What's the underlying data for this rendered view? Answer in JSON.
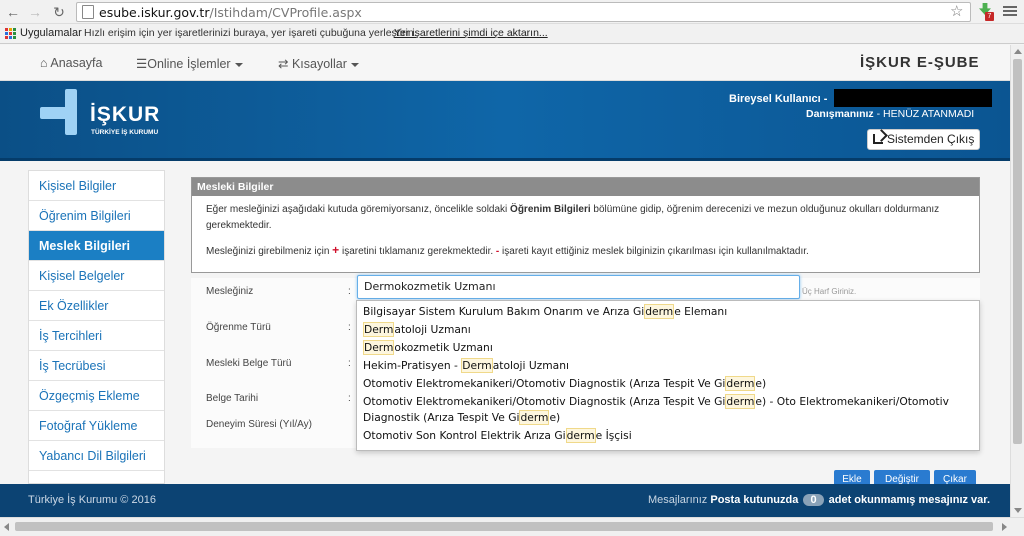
{
  "browser": {
    "url_host": "esube.iskur.gov.tr",
    "url_path": "/Istihdam/CVProfile.aspx",
    "bookmarks": {
      "apps_label": "Uygulamalar",
      "hint": "Hızlı erişim için yer işaretlerinizi buraya, yer işareti çubuğuna yerleştirin.",
      "import_link": "Yer işaretlerini şimdi içe aktarın..."
    },
    "extension_badge": "7"
  },
  "nav": {
    "home": "Anasayfa",
    "online": "Online İşlemler",
    "shortcuts": "Kısayollar",
    "brand": "İŞKUR E-ŞUBE"
  },
  "header": {
    "logo_name": "İŞKUR",
    "logo_sub": "TÜRKİYE İŞ KURUMU",
    "user_label": "Bireysel Kullanıcı -",
    "advisor_label": "Danışmanınız",
    "advisor_value": " - HENÜZ ATANMADI",
    "logout": "Sistemden Çıkış"
  },
  "sidebar": {
    "items": [
      {
        "label": "Kişisel Bilgiler"
      },
      {
        "label": "Öğrenim Bilgileri"
      },
      {
        "label": "Meslek Bilgileri",
        "active": true
      },
      {
        "label": "Kişisel Belgeler"
      },
      {
        "label": "Ek Özellikler"
      },
      {
        "label": "İş Tercihleri"
      },
      {
        "label": "İş Tecrübesi"
      },
      {
        "label": "Özgeçmiş Ekleme"
      },
      {
        "label": "Fotoğraf Yükleme"
      },
      {
        "label": "Yabancı Dil Bilgileri"
      }
    ]
  },
  "panel": {
    "title": "Mesleki Bilgiler",
    "info_1a": "Eğer mesleğinizi aşağıdaki kutuda göremiyorsanız, öncelikle soldaki ",
    "info_1b": "Öğrenim Bilgileri",
    "info_1c": " bölümüne gidip, öğrenim derecenizi ve mezun olduğunuz okulları doldurmanız gerekmektedir.",
    "info_2a": "Mesleğinizi girebilmeniz için ",
    "info_2plus": "+",
    "info_2b": " işaretini tıklamanız gerekmektedir. ",
    "info_2minus": "-",
    "info_2c": " işareti kayıt ettiğiniz meslek bilginizin çıkarılması için kullanılmaktadır."
  },
  "form": {
    "occupation_label": "Mesleğiniz",
    "occupation_value": "Dermokozmetik Uzmanı",
    "hint": "Üç Harf Giriniz.",
    "colon": ":",
    "learning_type_label": "Öğrenme Türü",
    "doc_type_label": "Mesleki Belge Türü",
    "doc_date_label": "Belge Tarihi",
    "experience_label": "Deneyim Süresi (Yıl/Ay)"
  },
  "autocomplete": [
    {
      "pre": "Bilgisayar Sistem Kurulum Bakım Onarım ve Arıza Gi",
      "hl": "derm",
      "post": "e Elemanı"
    },
    {
      "pre": "",
      "hl": "Derm",
      "post": "atoloji Uzmanı"
    },
    {
      "pre": "",
      "hl": "Derm",
      "post": "okozmetik Uzmanı"
    },
    {
      "pre": "Hekim-Pratisyen - ",
      "hl": "Derm",
      "post": "atoloji Uzmanı"
    },
    {
      "pre": "Otomotiv Elektromekanikeri/Otomotiv Diagnostik (Arıza Tespit Ve Gi",
      "hl": "derm",
      "post": "e)"
    },
    {
      "pre": "Otomotiv Elektromekanikeri/Otomotiv Diagnostik (Arıza Tespit Ve Gi",
      "hl": "derm",
      "mid": "e) - Oto Elektromekanikeri/Otomotiv Diagnostik (Arıza Tespit Ve Gi",
      "hl2": "derm",
      "post": "e)"
    },
    {
      "pre": "Otomotiv Son Kontrol Elektrik Arıza Gi",
      "hl": "derm",
      "post": "e İşçisi"
    }
  ],
  "buttons": {
    "add": "Ekle",
    "change": "Değiştir",
    "remove": "Çıkar"
  },
  "footer": {
    "copyright": "Türkiye İş Kurumu © 2016",
    "messages": "Mesajlarınız",
    "inbox": "Posta kutunuzda",
    "count": "0",
    "unread": "adet okunmamış mesajınız var."
  },
  "colors": {
    "brand_blue": "#0f66a8",
    "active_item": "#1b7fc4",
    "button_blue": "#2a7bd0",
    "footer": "#0c4373"
  }
}
